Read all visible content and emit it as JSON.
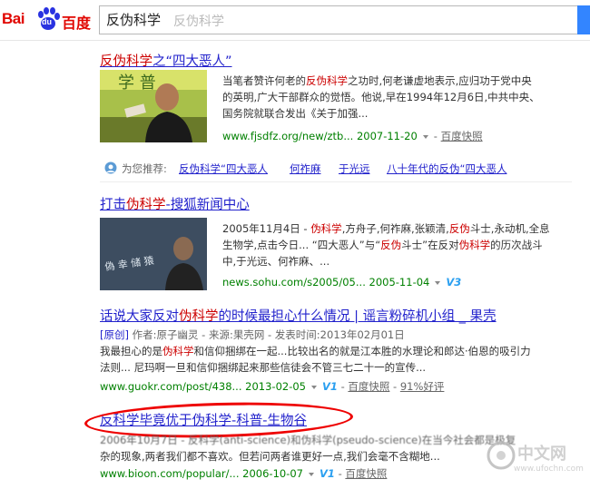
{
  "logo": {
    "bai": "Bai",
    "du": "du",
    "cn": "百度"
  },
  "search": {
    "query": "反伪科学",
    "hint": "反伪科学"
  },
  "results": [
    {
      "title": [
        "反伪科学",
        "之“四大恶人”"
      ],
      "abstract": [
        [
          "当笔者赞许何老的",
          "反伪科学",
          "之功时,何老谦虚地表示,应归功于党中央"
        ],
        [
          "的英明,广大干部群众的觉悟。他说,早在1994年12月6日,中共中央、"
        ],
        [
          "国务院就联合发出《关于加强..."
        ]
      ],
      "url": "www.fjsdfz.org/new/ztb...",
      "date": "2007-11-20",
      "kuaizhao": "百度快照"
    },
    {
      "title": [
        "打击",
        "伪科学",
        "-搜狐新闻中心"
      ],
      "abstract": [
        [
          "2005年11月4日 - ",
          "伪科学",
          ",方舟子,何祚麻,张颖清,",
          "反伪",
          "斗士,永动机,全息"
        ],
        [
          "生物学,点击今日... “四大恶人”与“",
          "反伪",
          "斗士”在反对",
          "伪科学",
          "的历次战斗"
        ],
        [
          "中,于光远、何祚麻、..."
        ]
      ],
      "url": "news.sohu.com/s2005/05...",
      "date": "2005-11-04",
      "badge": "V3"
    },
    {
      "title": [
        "话说大家反对",
        "伪科学",
        "的时候最担心什么情况 | 谣言粉碎机小组 _ 果壳"
      ],
      "meta": {
        "yuanchuang": "[原创]",
        "text": " 作者:原子幽灵 - 来源:果壳网 - 发表时间:2013年02月01日"
      },
      "abstract": [
        [
          "我最担心的是",
          "伪科学",
          "和信仰捆绑在一起...比较出名的就是江本胜的水理论和郎达·伯恩的吸引力"
        ],
        [
          "法则... 尼玛啊一旦和信仰捆绑起来那些信徒会不管三七二十一的宣传..."
        ]
      ],
      "url": "www.guokr.com/post/438...",
      "date": "2013-02-05",
      "badge": "V1",
      "kuaizhao": "百度快照",
      "haoping": "91%好评"
    },
    {
      "title": [
        "反科学毕竟优于伪科学-科普-生物谷"
      ],
      "abstract": [
        [
          "2006年10月7日 - 反科学(anti-science)和伪科学(pseudo-science)在当今社会都是极复"
        ],
        [
          "杂的现象,两者我们都不喜欢。但若问两者谁更好一点,我们会毫不含糊地..."
        ]
      ],
      "url": "www.bioon.com/popular/...",
      "date": "2006-10-07",
      "badge": "V1",
      "kuaizhao": "百度快照"
    }
  ],
  "recommend": {
    "label": "为您推荐:",
    "items": [
      "反伪科学“四大恶人",
      "何祚麻",
      "于光远",
      "八十年代的反伪“四大恶人"
    ]
  },
  "watermark": {
    "title": "中文网",
    "site": "www.ufochn.com"
  },
  "colors": {
    "link": "#2222cc",
    "highlight": "#cc0000",
    "url": "#008000",
    "brand": "#e10601",
    "search_button": "#3385ff",
    "annotation": "#ee0000"
  }
}
